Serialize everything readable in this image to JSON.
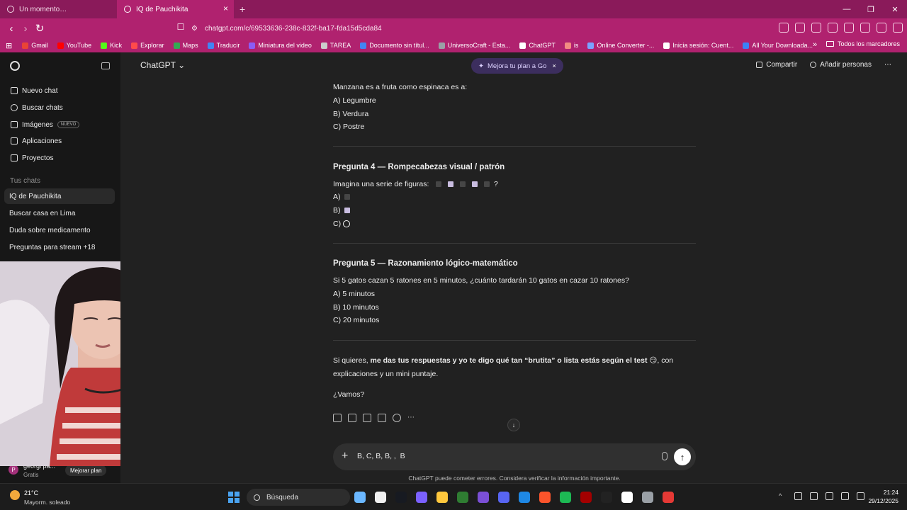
{
  "browser": {
    "tabs": [
      {
        "title": "Un momento…",
        "active": false
      },
      {
        "title": "IQ de Pauchikita",
        "active": true
      }
    ],
    "url": "chatgpt.com/c/69533636-238c-832f-ba17-fda15d5cda84",
    "bookmarks": [
      {
        "label": "Gmail",
        "color": "#ea4335"
      },
      {
        "label": "YouTube",
        "color": "#ff0000"
      },
      {
        "label": "Kick",
        "color": "#53fc18"
      },
      {
        "label": "Explorar",
        "color": "#ff4a4a"
      },
      {
        "label": "Maps",
        "color": "#34a853"
      },
      {
        "label": "Traducir",
        "color": "#4285f4"
      },
      {
        "label": "Miniatura del video",
        "color": "#8b5cf6"
      },
      {
        "label": "TAREA",
        "color": "#cccccc"
      },
      {
        "label": "Documento sin títul...",
        "color": "#4285f4"
      },
      {
        "label": "UniversoCraft - Esta...",
        "color": "#9aa0a6"
      },
      {
        "label": "ChatGPT",
        "color": "#ffffff"
      },
      {
        "label": "is",
        "color": "#f28b82"
      },
      {
        "label": "Online Converter -...",
        "color": "#7aa2ff"
      },
      {
        "label": "Inicia sesión: Cuent...",
        "color": "#ffffff"
      },
      {
        "label": "All Your Downloada...",
        "color": "#3b82f6"
      }
    ],
    "bookmarks_more": "»",
    "bookmarks_all": "Todos los marcadores",
    "theme_color": "#b0226f"
  },
  "sidebar": {
    "items": [
      {
        "label": "Nuevo chat",
        "icon": "new-chat-icon"
      },
      {
        "label": "Buscar chats",
        "icon": "search-icon"
      },
      {
        "label": "Imágenes",
        "icon": "images-icon",
        "badge": "NUEVO"
      },
      {
        "label": "Aplicaciones",
        "icon": "apps-icon"
      },
      {
        "label": "Proyectos",
        "icon": "folder-icon"
      }
    ],
    "section_title": "Tus chats",
    "chats": [
      {
        "label": "IQ de Pauchikita",
        "active": true
      },
      {
        "label": "Buscar casa en Lima",
        "active": false
      },
      {
        "label": "Duda sobre medicamento",
        "active": false
      },
      {
        "label": "Preguntas para stream +18",
        "active": false
      }
    ],
    "user": {
      "initial": "P",
      "name": "georgi pa...",
      "plan": "Gratis",
      "upgrade_label": "Mejorar plan"
    }
  },
  "header": {
    "title": "ChatGPT",
    "plan_pill": "Mejora tu plan a Go",
    "share_label": "Compartir",
    "add_people_label": "Añadir personas",
    "more": "⋯"
  },
  "conversation": {
    "q3_prompt": "Manzana es a fruta como espinaca es a:",
    "q3_options": [
      "A) Legumbre",
      "B) Verdura",
      "C) Postre"
    ],
    "q4_title": "Pregunta 4 — Rompecabezas visual / patrón",
    "q4_prompt": "Imagina una serie de figuras:",
    "q4_series_end": "?",
    "q4_options": [
      "A)",
      "B)",
      "C)"
    ],
    "q5_title": "Pregunta 5 — Razonamiento lógico-matemático",
    "q5_prompt": "Si 5 gatos cazan 5 ratones en 5 minutos, ¿cuánto tardarán 10 gatos en cazar 10 ratones?",
    "q5_options": [
      "A) 5 minutos",
      "B) 10 minutos",
      "C) 20 minutos"
    ],
    "closing_prefix": "Si quieres, ",
    "closing_bold": "me das tus respuestas y yo te digo qué tan “brutita” o lista estás según el test",
    "closing_emoji": "😏",
    "closing_suffix": ", con",
    "closing_line2": "explicaciones y un mini puntaje.",
    "closing_question": "¿Vamos?"
  },
  "composer": {
    "text": "B, C, B, B, ,  B",
    "disclaimer": "ChatGPT puede cometer errores. Considera verificar la información importante."
  },
  "taskbar": {
    "temp": "21°C",
    "weather": "Mayorm. soleado",
    "search_label": "Búsqueda",
    "time": "21:24",
    "date": "29/12/2025",
    "apps": [
      "#6ab7ff",
      "#f0f0f0",
      "#171a21",
      "#7b61ff",
      "#ffc83d",
      "#2f7d32",
      "#7b4fd6",
      "#5865f2",
      "#1e88e5",
      "#fb542b",
      "#1db954",
      "#a30000",
      "#222222",
      "#ffffff",
      "#9aa0a6",
      "#e53935"
    ]
  }
}
